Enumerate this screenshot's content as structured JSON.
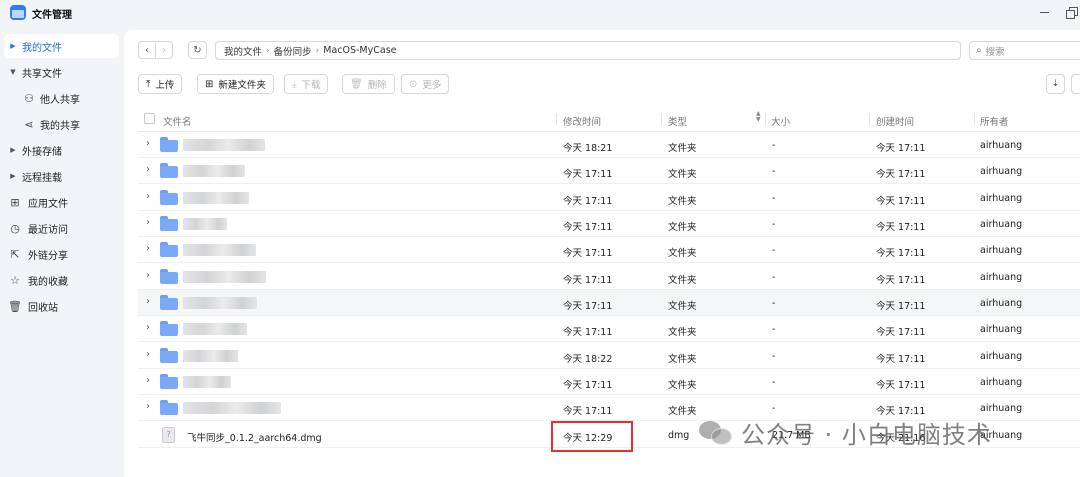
{
  "app": {
    "title": "文件管理"
  },
  "sidebar": {
    "items": [
      {
        "label": "我的文件",
        "icon": "caret-right-icon",
        "active": true
      },
      {
        "label": "共享文件",
        "icon": "caret-down-icon"
      },
      {
        "label": "他人共享",
        "icon": "user-share-icon",
        "sub": true
      },
      {
        "label": "我的共享",
        "icon": "share-icon",
        "sub": true
      },
      {
        "label": "外接存储",
        "icon": "caret-right-icon"
      },
      {
        "label": "远程挂载",
        "icon": "caret-right-icon"
      },
      {
        "label": "应用文件",
        "icon": "apps-icon"
      },
      {
        "label": "最近访问",
        "icon": "clock-icon"
      },
      {
        "label": "外链分享",
        "icon": "external-link-icon"
      },
      {
        "label": "我的收藏",
        "icon": "star-icon"
      },
      {
        "label": "回收站",
        "icon": "trash-icon"
      }
    ]
  },
  "breadcrumb": [
    "我的文件",
    "备份同步",
    "MacOS-MyCase"
  ],
  "search": {
    "placeholder": "搜索"
  },
  "toolbar": {
    "upload": "上传",
    "new_folder": "新建文件夹",
    "download": "下载",
    "delete": "删除",
    "more": "更多"
  },
  "columns": {
    "name": "文件名",
    "modified": "修改时间",
    "type": "类型",
    "size": "大小",
    "created": "创建时间",
    "owner": "所有者"
  },
  "rows": [
    {
      "modified": "今天 18:21",
      "type": "文件夹",
      "size": "-",
      "created": "今天 17:11",
      "owner": "airhuang"
    },
    {
      "modified": "今天 17:11",
      "type": "文件夹",
      "size": "-",
      "created": "今天 17:11",
      "owner": "airhuang"
    },
    {
      "modified": "今天 17:11",
      "type": "文件夹",
      "size": "-",
      "created": "今天 17:11",
      "owner": "airhuang"
    },
    {
      "modified": "今天 17:11",
      "type": "文件夹",
      "size": "-",
      "created": "今天 17:11",
      "owner": "airhuang"
    },
    {
      "modified": "今天 17:11",
      "type": "文件夹",
      "size": "-",
      "created": "今天 17:11",
      "owner": "airhuang"
    },
    {
      "modified": "今天 17:11",
      "type": "文件夹",
      "size": "-",
      "created": "今天 17:11",
      "owner": "airhuang"
    },
    {
      "modified": "今天 17:11",
      "type": "文件夹",
      "size": "-",
      "created": "今天 17:11",
      "owner": "airhuang"
    },
    {
      "modified": "今天 17:11",
      "type": "文件夹",
      "size": "-",
      "created": "今天 17:11",
      "owner": "airhuang"
    },
    {
      "modified": "今天 18:22",
      "type": "文件夹",
      "size": "-",
      "created": "今天 17:11",
      "owner": "airhuang"
    },
    {
      "modified": "今天 17:11",
      "type": "文件夹",
      "size": "-",
      "created": "今天 17:11",
      "owner": "airhuang"
    },
    {
      "modified": "今天 17:11",
      "type": "文件夹",
      "size": "-",
      "created": "今天 17:11",
      "owner": "airhuang"
    }
  ],
  "file_row": {
    "name": "飞牛同步_0.1.2_aarch64.dmg",
    "modified": "今天 12:29",
    "type": "dmg",
    "size": "21.7 MB",
    "created": "今天 21:16",
    "owner": "airhuang"
  },
  "watermark": "公众号 · 小白电脑技术",
  "colors": {
    "accent": "#1f6fe5",
    "highlight": "#e53030",
    "folder": "#7aa9f7"
  }
}
